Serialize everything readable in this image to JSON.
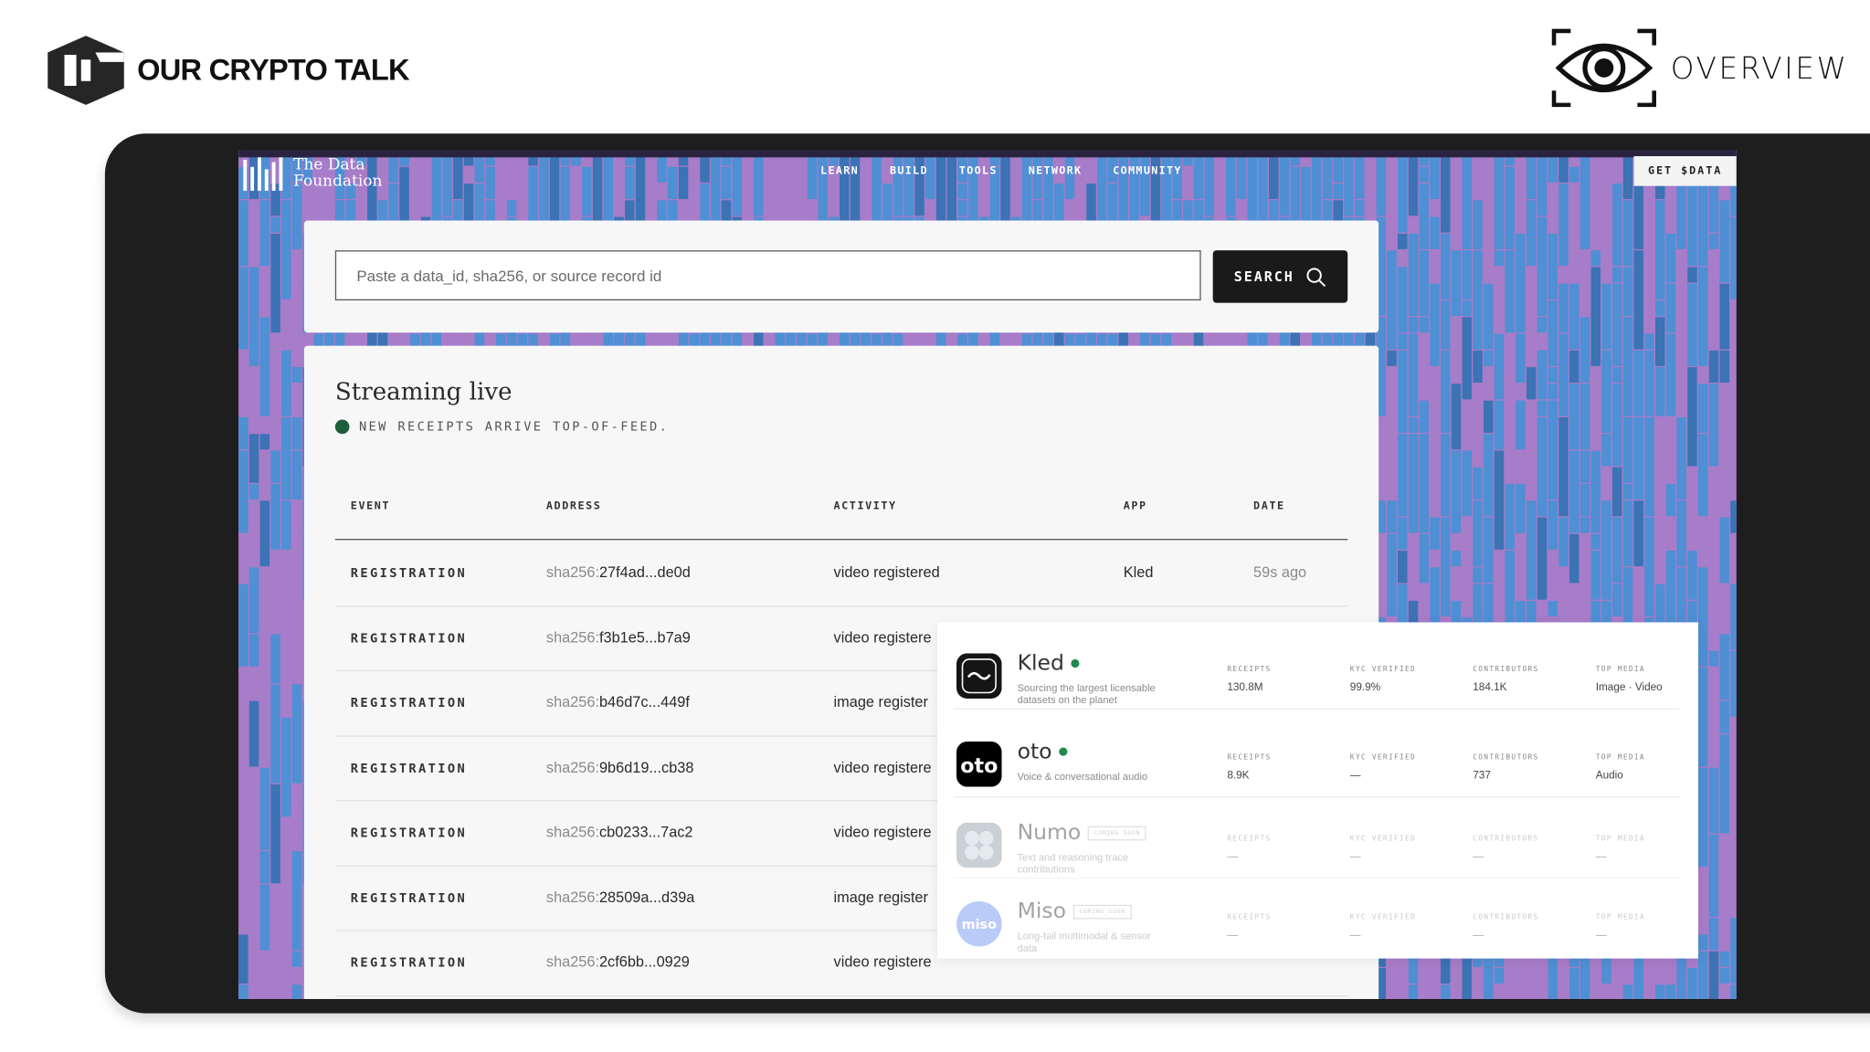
{
  "brand": {
    "name": "OUR CRYPTO TALK",
    "mark": "ctalk-logo-icon"
  },
  "overview": {
    "label": "OVERVIEW",
    "icon": "eye-icon"
  },
  "site": {
    "logo_line1": "The Data",
    "logo_line2": "Foundation",
    "nav": [
      "LEARN",
      "BUILD",
      "TOOLS",
      "NETWORK",
      "COMMUNITY"
    ],
    "cta": "GET $DATA"
  },
  "search": {
    "placeholder": "Paste a data_id, sha256, or source record id",
    "button": "SEARCH"
  },
  "stream": {
    "title": "Streaming live",
    "subtitle": "NEW RECEIPTS ARRIVE TOP-OF-FEED.",
    "columns": [
      "EVENT",
      "ADDRESS",
      "ACTIVITY",
      "APP",
      "DATE"
    ],
    "rows": [
      {
        "event": "REGISTRATION",
        "addr_prefix": "sha256:",
        "addr": "27f4ad...de0d",
        "activity": "video registered",
        "app": "Kled",
        "date": "59s ago"
      },
      {
        "event": "REGISTRATION",
        "addr_prefix": "sha256:",
        "addr": "f3b1e5...b7a9",
        "activity": "video registere",
        "app": "",
        "date": ""
      },
      {
        "event": "REGISTRATION",
        "addr_prefix": "sha256:",
        "addr": "b46d7c...449f",
        "activity": "image register",
        "app": "",
        "date": ""
      },
      {
        "event": "REGISTRATION",
        "addr_prefix": "sha256:",
        "addr": "9b6d19...cb38",
        "activity": "video registere",
        "app": "",
        "date": ""
      },
      {
        "event": "REGISTRATION",
        "addr_prefix": "sha256:",
        "addr": "cb0233...7ac2",
        "activity": "video registere",
        "app": "",
        "date": ""
      },
      {
        "event": "REGISTRATION",
        "addr_prefix": "sha256:",
        "addr": "28509a...d39a",
        "activity": "image register",
        "app": "",
        "date": ""
      },
      {
        "event": "REGISTRATION",
        "addr_prefix": "sha256:",
        "addr": "2cf6bb...0929",
        "activity": "video registere",
        "app": "",
        "date": ""
      }
    ]
  },
  "apps": [
    {
      "name": "Kled",
      "live": true,
      "coming_soon": "",
      "desc": "Sourcing the largest licensable datasets on the planet",
      "icon": "kled-wave-icon",
      "metrics": [
        {
          "label": "RECEIPTS",
          "value": "130.8M"
        },
        {
          "label": "KYC VERIFIED",
          "value": "99.9%"
        },
        {
          "label": "CONTRIBUTORS",
          "value": "184.1K"
        },
        {
          "label": "TOP MEDIA",
          "value": "Image · Video"
        }
      ]
    },
    {
      "name": "oto",
      "live": true,
      "coming_soon": "",
      "desc": "Voice & conversational audio",
      "icon": "oto-logo-icon",
      "metrics": [
        {
          "label": "RECEIPTS",
          "value": "8.9K"
        },
        {
          "label": "KYC VERIFIED",
          "value": "—"
        },
        {
          "label": "CONTRIBUTORS",
          "value": "737"
        },
        {
          "label": "TOP MEDIA",
          "value": "Audio"
        }
      ]
    },
    {
      "name": "Numo",
      "live": false,
      "coming_soon": "COMING SOON",
      "desc": "Text and reasoning trace contributions",
      "icon": "numo-logo-icon",
      "metrics": [
        {
          "label": "RECEIPTS",
          "value": "—"
        },
        {
          "label": "KYC VERIFIED",
          "value": "—"
        },
        {
          "label": "CONTRIBUTORS",
          "value": "—"
        },
        {
          "label": "TOP MEDIA",
          "value": "—"
        }
      ]
    },
    {
      "name": "Miso",
      "live": false,
      "coming_soon": "COMING SOON",
      "desc": "Long-tail multimodal & sensor data",
      "icon": "miso-logo-icon",
      "icon_text": "miso",
      "metrics": [
        {
          "label": "RECEIPTS",
          "value": "—"
        },
        {
          "label": "KYC VERIFIED",
          "value": "—"
        },
        {
          "label": "CONTRIBUTORS",
          "value": "—"
        },
        {
          "label": "TOP MEDIA",
          "value": "—"
        }
      ]
    }
  ],
  "colors": {
    "bg_purple": "#a77cc8",
    "bg_blue": "#4f8fd4",
    "live_dot": "#1f5e3c",
    "live_green": "#1f8a4c",
    "miso": "#6b8df0"
  }
}
